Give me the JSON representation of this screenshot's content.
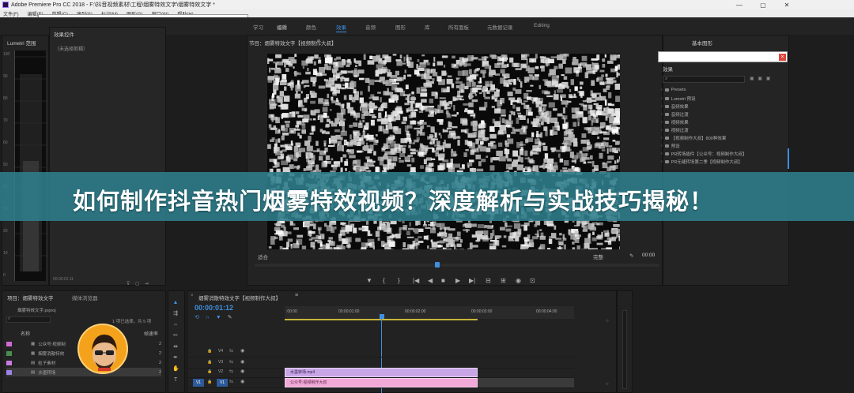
{
  "window": {
    "title": "Adobe Premiere Pro CC 2018 - F:\\抖音视频素材\\工程\\烟雾特效文字\\烟雾特效文字 *"
  },
  "menu": [
    "文件(F)",
    "编辑(E)",
    "剪辑(C)",
    "序列(S)",
    "标记(M)",
    "图形(G)",
    "窗口(W)",
    "帮助(H)"
  ],
  "workspaces": [
    {
      "label": "学习",
      "active": false
    },
    {
      "label": "组件",
      "active": false
    },
    {
      "label": "编辑",
      "active": false
    },
    {
      "label": "颜色",
      "active": false
    },
    {
      "label": "效果",
      "active": true
    },
    {
      "label": "音频",
      "active": false
    },
    {
      "label": "图形",
      "active": false
    },
    {
      "label": "库",
      "active": false
    },
    {
      "label": "所有面板",
      "active": false
    },
    {
      "label": "元数据记录",
      "active": false
    },
    {
      "label": "Editing",
      "active": false
    }
  ],
  "scope_panel": {
    "title": "Lumetri 范围",
    "labels": [
      "100",
      "90",
      "80",
      "70",
      "60",
      "50",
      "40",
      "30",
      "20",
      "10",
      "0"
    ],
    "timecode": "00:00:01:11"
  },
  "effect_controls": {
    "title": "效果控件",
    "subtitle": "（未选择剪辑）"
  },
  "program_monitor": {
    "title": "节目：烟雾特效文字【视频制作大叔】",
    "fit": "适合",
    "quality": "完整",
    "timecode_right": "00:00"
  },
  "essential_graphics": {
    "title": "基本图形"
  },
  "effects_panel": {
    "title": "效果",
    "items": [
      "Presets",
      "Lumetri 预设",
      "音频效果",
      "音频过渡",
      "视频效果",
      "视频过渡",
      "【视频制作大叔】800种效果",
      "预设",
      "PR转场插件【公众号：视频制作大叔】",
      "PR无缝转场第二季【视频制作大叔】"
    ]
  },
  "banner": {
    "text": "如何制作抖音热门烟雾特效视频？深度解析与实战技巧揭秘！"
  },
  "project_panel": {
    "tabs": [
      "项目：烟雾特效文字",
      "媒体浏览器"
    ],
    "file": "烟雾特效文字.prproj",
    "selection_info": "1 项已选择，共 5 项",
    "col_name": "名称",
    "col_rate": "帧速率",
    "rows": [
      {
        "name": "公众号:视频制",
        "color": "#d26ad6"
      },
      {
        "name": "烟雾消散特效",
        "color": "#4a8e4e"
      },
      {
        "name": "粒子素材",
        "color": "#c77dde"
      },
      {
        "name": "水墨转场",
        "color": "#9b82e6"
      }
    ],
    "rate_values": [
      "2",
      "2",
      "2",
      "2"
    ]
  },
  "timeline": {
    "tab": "烟雾消散特效文字【视频制作大叔】",
    "timecode": "00:00:01:12",
    "ruler": [
      ":00:00",
      "00:00:01:00",
      "00:00:02:00",
      "00:00:03:00",
      "00:00:04:00"
    ],
    "tracks": [
      "V4",
      "V3",
      "V2",
      "V1"
    ],
    "clips": [
      {
        "label": "水墨转场.mp4",
        "kind": "purple"
      },
      {
        "label": "公众号:视频制作大叔",
        "kind": "pink"
      }
    ]
  },
  "transport_icons": [
    "marker",
    "in-point",
    "out-point",
    "go-to-in",
    "step-back",
    "play",
    "step-forward",
    "go-to-out",
    "insert",
    "overwrite",
    "export-frame",
    "settings"
  ]
}
